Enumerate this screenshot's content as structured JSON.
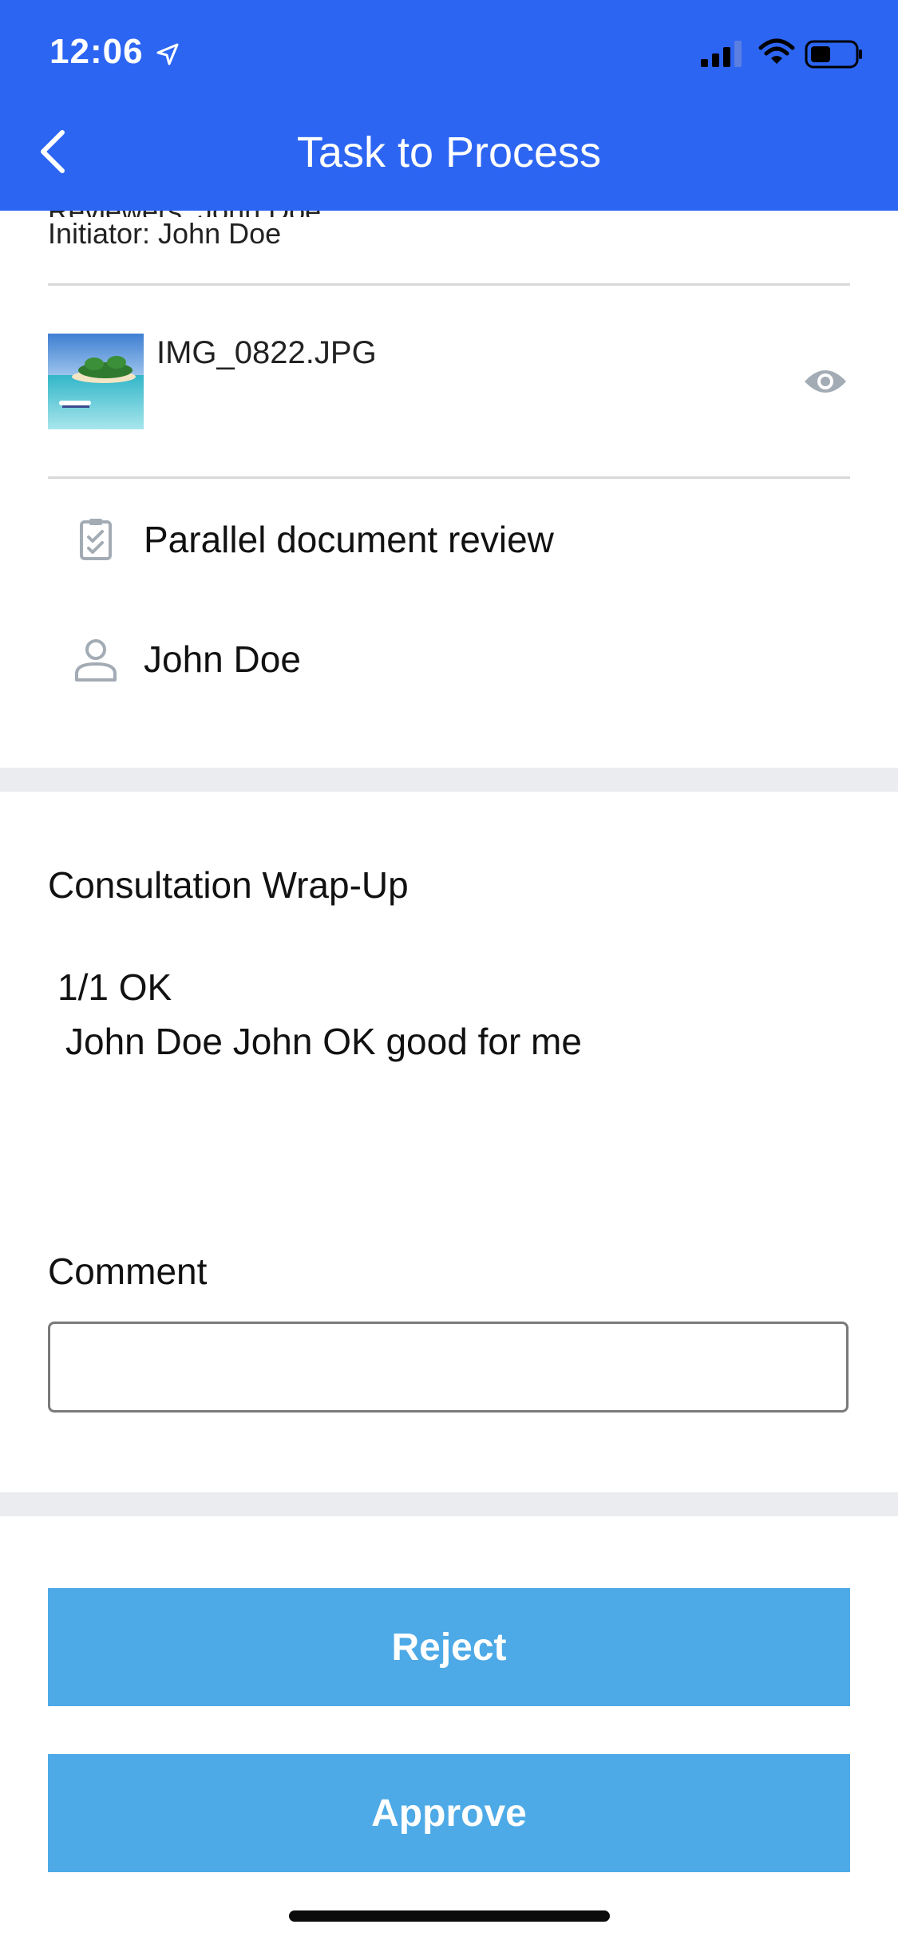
{
  "status_bar": {
    "time": "12:06"
  },
  "header": {
    "title": "Task to Process"
  },
  "task": {
    "clipped_line": "Reviewers: John Doe",
    "initiator": "Initiator: John Doe"
  },
  "attachment": {
    "file_name": "IMG_0822.JPG"
  },
  "details": {
    "workflow": "Parallel document review",
    "assignee": "John Doe"
  },
  "wrapup": {
    "title": "Consultation Wrap-Up",
    "line1": "1/1 OK",
    "line2": "John Doe John OK good for me"
  },
  "comment": {
    "label": "Comment",
    "placeholder": "",
    "value": ""
  },
  "actions": {
    "reject_label": "Reject",
    "approve_label": "Approve"
  },
  "colors": {
    "header": "#2d65f3",
    "button": "#4eaae6",
    "separator": "#eaecef",
    "icon_gray": "#a3acb4"
  },
  "icons": [
    "location-arrow-icon",
    "signal-icon",
    "wifi-icon",
    "battery-icon",
    "back-chevron-icon",
    "eye-icon",
    "checklist-icon",
    "person-icon"
  ]
}
